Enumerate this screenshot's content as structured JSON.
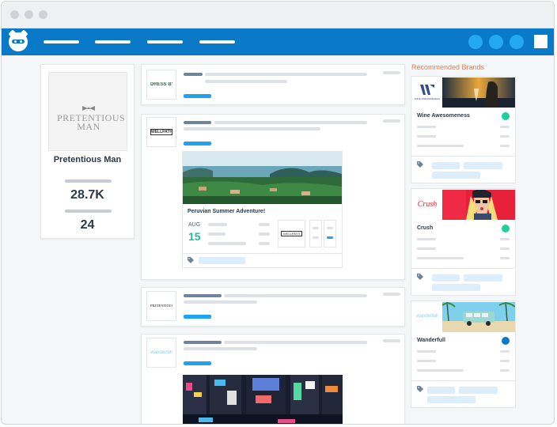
{
  "profile": {
    "logo_text": "PRETENTIOUS MAN",
    "name": "Pretentious Man",
    "stat_1": "28.7K",
    "stat_2": "24"
  },
  "feed": {
    "event": {
      "title": "Peruvian Summer Adventure!",
      "month": "AUG",
      "day": "15",
      "brand_logo_text": "WELLPATH"
    },
    "posts": [
      {
        "logo_text": "DRESS BY GALA"
      },
      {
        "logo_text": "WELLPATH"
      },
      {
        "logo_text": "PRETENTIOUS MAN"
      },
      {
        "logo_text": "wanderfull"
      }
    ]
  },
  "sidebar": {
    "title": "Recommended Brands",
    "brands": [
      {
        "name": "Wine Awesomeness",
        "logo_text": "WINE AWESOMENESS",
        "dot_color": "#1fcf9a"
      },
      {
        "name": "Crush",
        "logo_text": "Crush",
        "dot_color": "#1fcf9a"
      },
      {
        "name": "Wanderfull",
        "logo_text": "wanderfull",
        "dot_color": "#0a79c8"
      }
    ]
  },
  "colors": {
    "nav": "#0a79c8",
    "accent_blue": "#1fa3ee",
    "accent_orange": "#f07b4b",
    "accent_green": "#1fbd9a"
  }
}
